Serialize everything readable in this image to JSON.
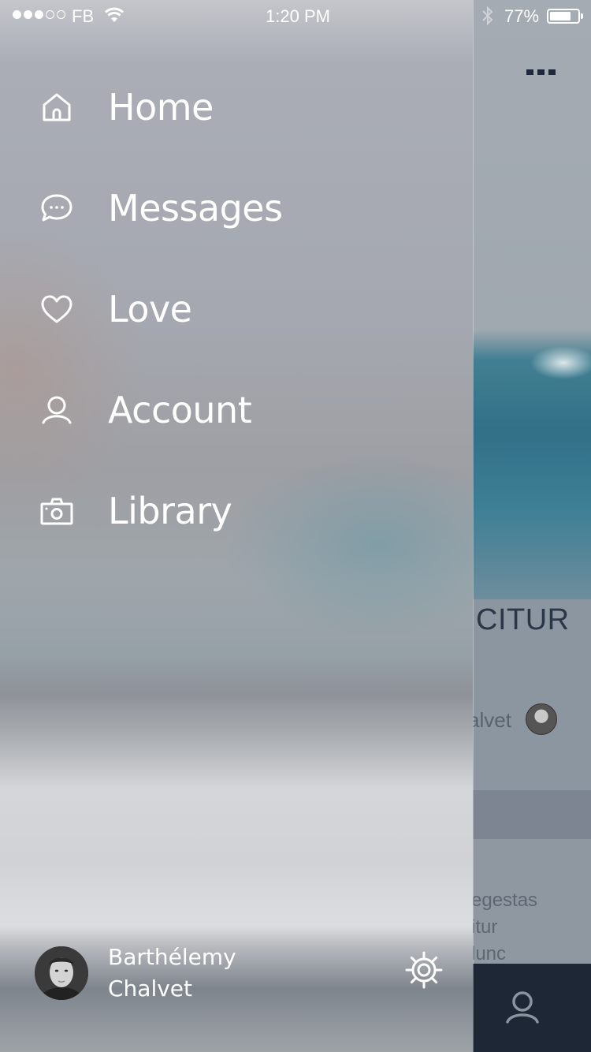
{
  "status_bar": {
    "carrier": "FB",
    "time": "1:20 PM",
    "battery_percent": "77%",
    "battery_level": 0.77,
    "signal_filled": 3,
    "signal_total": 5
  },
  "background_page": {
    "title_fragment": "CITUR",
    "author_fragment": "alvet",
    "text_fragment": [
      "egestas",
      "itur",
      "lunc"
    ]
  },
  "menu": {
    "items": [
      {
        "label": "Home",
        "icon": "home-icon"
      },
      {
        "label": "Messages",
        "icon": "chat-bubble-icon"
      },
      {
        "label": "Love",
        "icon": "heart-icon"
      },
      {
        "label": "Account",
        "icon": "user-icon"
      },
      {
        "label": "Library",
        "icon": "camera-icon"
      }
    ]
  },
  "profile": {
    "first_name": "Barthélemy",
    "last_name": "Chalvet",
    "settings_icon": "gear-icon"
  },
  "colors": {
    "text": "#ffffff",
    "tabbar": "#1d2735",
    "heading_dark": "#2b3647"
  }
}
